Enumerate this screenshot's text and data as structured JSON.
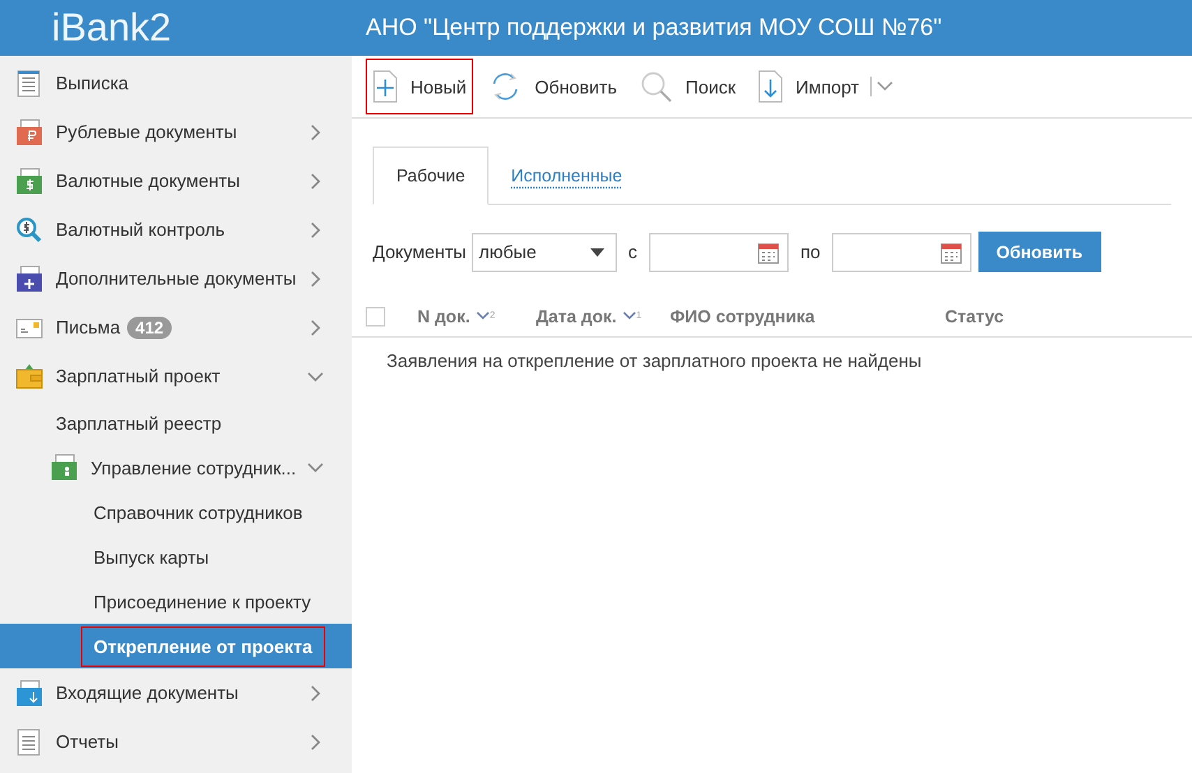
{
  "header": {
    "logo": "iBank2",
    "title": "АНО \"Центр поддержки и развития МОУ СОШ №76\""
  },
  "sidebar": {
    "items": [
      {
        "label": "Выписка",
        "selected": false,
        "highlighted": false
      },
      {
        "label": "Рублевые документы",
        "expanded": false,
        "selected": false,
        "highlighted": false
      },
      {
        "label": "Валютные документы",
        "expanded": false,
        "selected": false,
        "highlighted": false
      },
      {
        "label": "Валютный контроль",
        "expanded": false,
        "selected": false,
        "highlighted": false
      },
      {
        "label": "Дополнительные документы",
        "expanded": false,
        "selected": false,
        "highlighted": false
      },
      {
        "label": "Письма",
        "badge": "412",
        "expanded": false,
        "selected": false,
        "highlighted": false
      },
      {
        "label": "Зарплатный проект",
        "expanded": true,
        "selected": false,
        "highlighted": false,
        "children": [
          {
            "label": "Зарплатный реестр",
            "selected": false,
            "highlighted": false
          },
          {
            "label": "Управление сотрудник...",
            "expanded": true,
            "selected": false,
            "highlighted": false,
            "children": [
              {
                "label": "Справочник сотрудников",
                "selected": false,
                "highlighted": false
              },
              {
                "label": "Выпуск карты",
                "selected": false,
                "highlighted": false
              },
              {
                "label": "Присоединение к проекту",
                "selected": false,
                "highlighted": false
              },
              {
                "label": "Открепление от проекта",
                "selected": true,
                "highlighted": true
              }
            ]
          }
        ]
      },
      {
        "label": "Входящие документы",
        "expanded": false,
        "selected": false,
        "highlighted": false
      },
      {
        "label": "Отчеты",
        "expanded": false,
        "selected": false,
        "highlighted": false
      }
    ]
  },
  "toolbar": [
    {
      "label": "Новый",
      "highlighted": true
    },
    {
      "label": "Обновить",
      "highlighted": false
    },
    {
      "label": "Поиск",
      "highlighted": false
    },
    {
      "label": "Импорт",
      "highlighted": false,
      "dropdown": true
    }
  ],
  "tabs": [
    {
      "label": "Рабочие",
      "selected": true
    },
    {
      "label": "Исполненные",
      "selected": false
    }
  ],
  "filter": {
    "documents_label": "Документы",
    "documents_value": "любые",
    "from_label": "с",
    "to_label": "по",
    "button": "Обновить"
  },
  "table": {
    "select_all_checked": false,
    "columns": [
      {
        "label": "N док.",
        "sort_rank": "2"
      },
      {
        "label": "Дата док.",
        "sort_rank": "1"
      },
      {
        "label": "ФИО сотрудника"
      },
      {
        "label": "Статус"
      }
    ],
    "empty_message": "Заявления на открепление от зарплатного проекта не найдены"
  }
}
